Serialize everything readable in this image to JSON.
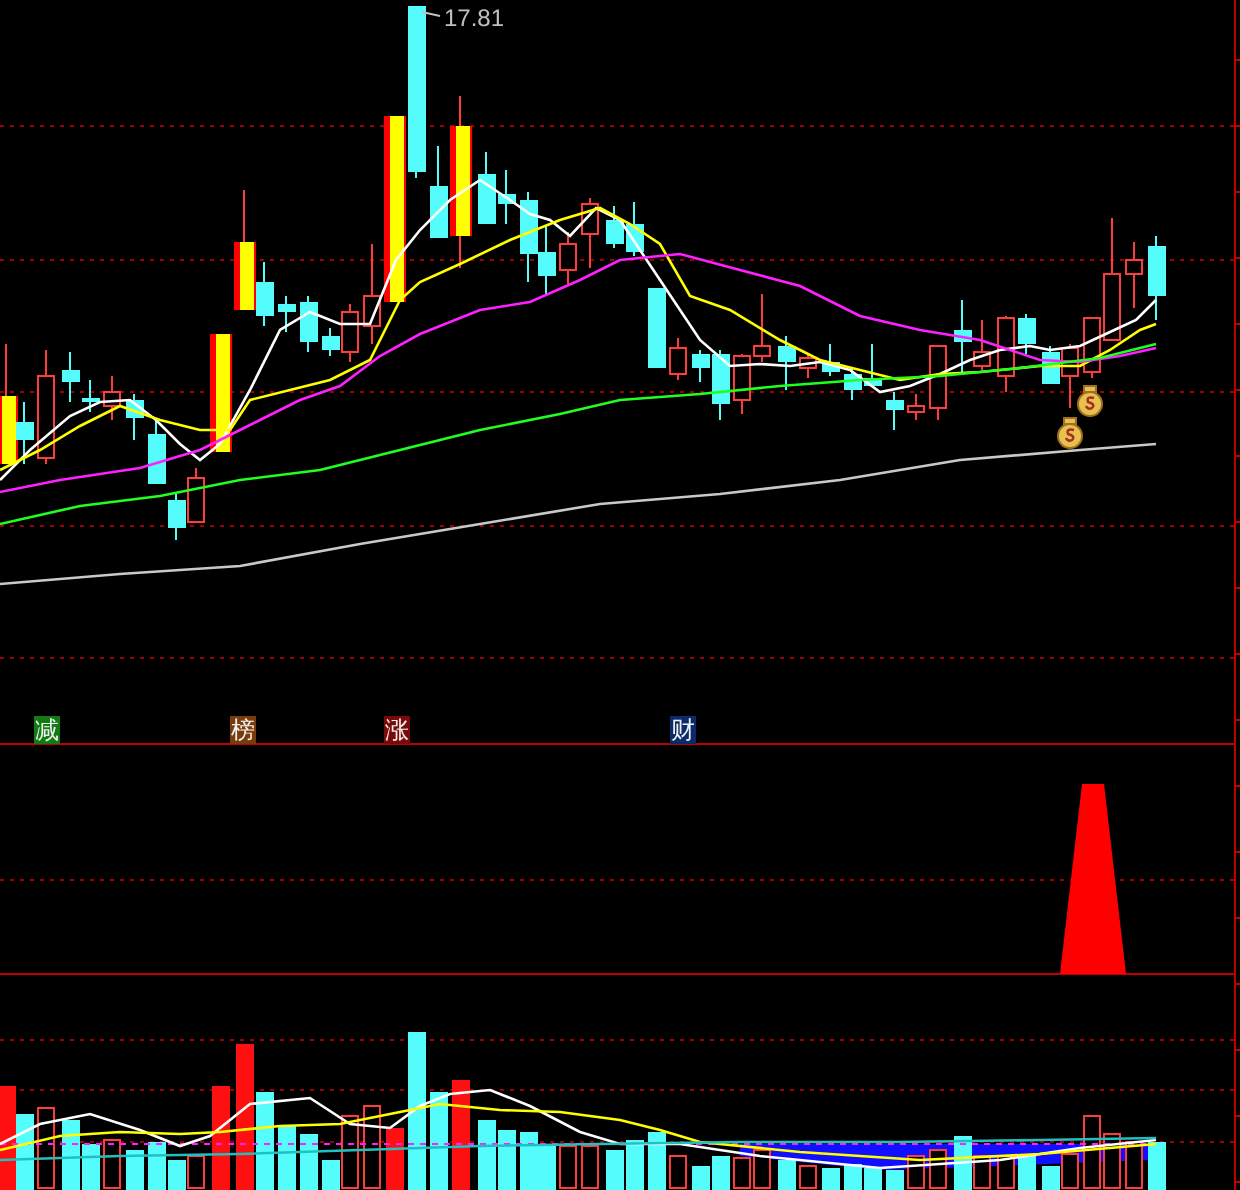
{
  "price_chart": {
    "high_label": "17.81"
  },
  "markers": [
    {
      "text": "减",
      "color": "#127a12"
    },
    {
      "text": "榜",
      "color": "#7a3a0a"
    },
    {
      "text": "涨",
      "color": "#7a0a0a"
    },
    {
      "text": "财",
      "color": "#0a2a6a"
    }
  ]
}
